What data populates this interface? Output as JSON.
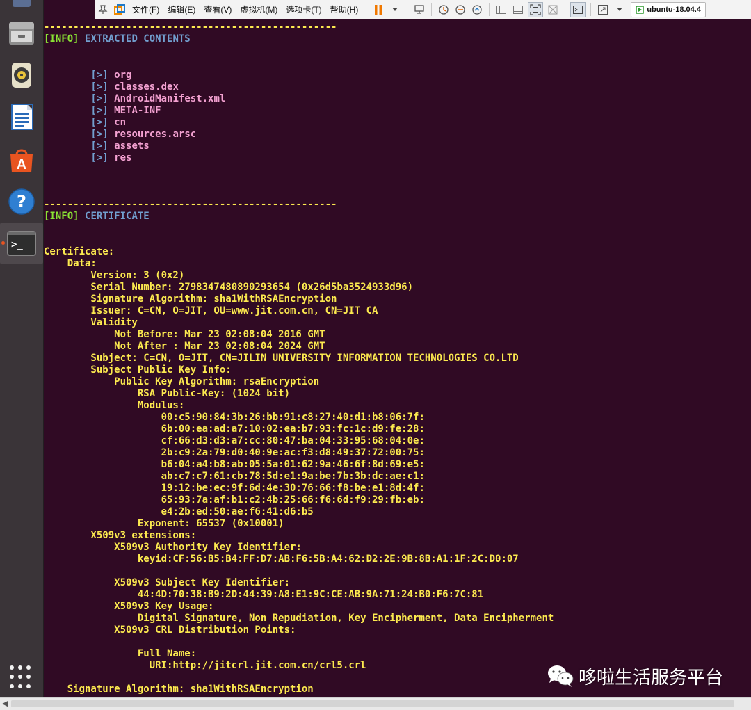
{
  "toolbar": {
    "menus": [
      "文件(F)",
      "编辑(E)",
      "查看(V)",
      "虚拟机(M)",
      "选项卡(T)",
      "帮助(H)"
    ],
    "vm_tab": "ubuntu-18.04.4"
  },
  "dock": {
    "items": [
      "files-icon",
      "rhythmbox-icon",
      "libreoffice-writer-icon",
      "software-center-icon",
      "help-icon",
      "terminal-icon"
    ],
    "accent": "#e95420"
  },
  "terminal": {
    "colors": {
      "background": "#300a24",
      "text": "#fce94f",
      "info_tag": "#8ae234",
      "info_title": "#729fcf",
      "bullet": "#729fcf",
      "file": "#f3a1d1"
    },
    "separator": "--------------------------------------------------",
    "info_tag": "[INFO]",
    "extracted_title": "EXTRACTED CONTENTS",
    "bullet": "[>]",
    "files": [
      "org",
      "classes.dex",
      "AndroidManifest.xml",
      "META-INF",
      "cn",
      "resources.arsc",
      "assets",
      "res"
    ],
    "certificate_title": "CERTIFICATE",
    "cert_lines": [
      "Certificate:",
      "    Data:",
      "        Version: 3 (0x2)",
      "        Serial Number: 2798347480890293654 (0x26d5ba3524933d96)",
      "        Signature Algorithm: sha1WithRSAEncryption",
      "        Issuer: C=CN, O=JIT, OU=www.jit.com.cn, CN=JIT CA",
      "        Validity",
      "            Not Before: Mar 23 02:08:04 2016 GMT",
      "            Not After : Mar 23 02:08:04 2024 GMT",
      "        Subject: C=CN, O=JIT, CN=JILIN UNIVERSITY INFORMATION TECHNOLOGIES CO.LTD",
      "        Subject Public Key Info:",
      "            Public Key Algorithm: rsaEncryption",
      "                RSA Public-Key: (1024 bit)",
      "                Modulus:",
      "                    00:c5:90:84:3b:26:bb:91:c8:27:40:d1:b8:06:7f:",
      "                    6b:00:ea:ad:a7:10:02:ea:b7:93:fc:1c:d9:fe:28:",
      "                    cf:66:d3:d3:a7:cc:80:47:ba:04:33:95:68:04:0e:",
      "                    2b:c9:2a:79:d0:40:9e:ac:f3:d8:49:37:72:00:75:",
      "                    b6:04:a4:b8:ab:05:5a:01:62:9a:46:6f:8d:69:e5:",
      "                    ab:c7:c7:61:cb:78:5d:e1:9a:be:7b:3b:dc:ae:c1:",
      "                    19:12:be:ec:9f:6d:4e:30:76:66:f8:be:e1:8d:4f:",
      "                    65:93:7a:af:b1:c2:4b:25:66:f6:6d:f9:29:fb:eb:",
      "                    e4:2b:ed:50:ae:f6:41:d6:b5",
      "                Exponent: 65537 (0x10001)",
      "        X509v3 extensions:",
      "            X509v3 Authority Key Identifier:",
      "                keyid:CF:56:B5:B4:FF:D7:AB:F6:5B:A4:62:D2:2E:9B:8B:A1:1F:2C:D0:07",
      "",
      "            X509v3 Subject Key Identifier:",
      "                44:4D:70:38:B9:2D:44:39:A8:E1:9C:CE:AB:9A:71:24:B0:F6:7C:81",
      "            X509v3 Key Usage:",
      "                Digital Signature, Non Repudiation, Key Encipherment, Data Encipherment",
      "            X509v3 CRL Distribution Points:",
      "",
      "                Full Name:",
      "                  URI:http://jitcrl.jit.com.cn/crl5.crl",
      "",
      "    Signature Algorithm: sha1WithRSAEncryption"
    ]
  },
  "watermark": "哆啦生活服务平台"
}
